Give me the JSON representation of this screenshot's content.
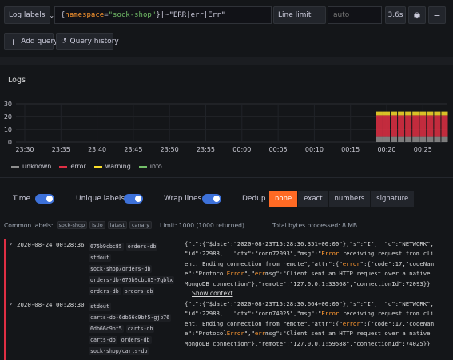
{
  "query_bar": {
    "log_labels_label": "Log labels",
    "query_parts": [
      {
        "text": "{",
        "color": "#ccccdc"
      },
      {
        "text": "namespace",
        "color": "#ff9830"
      },
      {
        "text": "=",
        "color": "#ccccdc"
      },
      {
        "text": "\"sock-shop\"",
        "color": "#73bf69"
      },
      {
        "text": "}",
        "color": "#ccccdc"
      },
      {
        "text": "|~\"ERR",
        "color": "#ccccdc"
      },
      {
        "text": "|",
        "color": "#ccccdc"
      },
      {
        "text": "err",
        "color": "#ccccdc"
      },
      {
        "text": "|",
        "color": "#ccccdc"
      },
      {
        "text": "Err\"",
        "color": "#ccccdc"
      }
    ],
    "line_limit_label": "Line limit",
    "line_limit_placeholder": "auto",
    "query_time": "3.6s",
    "add_query_label": "Add query",
    "query_history_label": "Query history"
  },
  "logs_panel": {
    "title": "Logs"
  },
  "chart_data": {
    "type": "bar",
    "stacked": true,
    "title": "",
    "ylim": [
      0,
      30
    ],
    "y_ticks": [
      "30",
      "20",
      "10",
      "0"
    ],
    "x_ticks": [
      "23:30",
      "23:35",
      "23:40",
      "23:45",
      "23:50",
      "23:55",
      "00:00",
      "00:05",
      "00:10",
      "00:15",
      "00:20",
      "00:25"
    ],
    "x": [
      "00:19",
      "00:20",
      "00:21",
      "00:22",
      "00:23",
      "00:24",
      "00:25",
      "00:26",
      "00:27",
      "00:28"
    ],
    "series": [
      {
        "name": "unknown",
        "color": "#8e8e8e",
        "values": [
          4,
          4,
          4,
          4,
          4,
          4,
          4,
          4,
          4,
          4
        ]
      },
      {
        "name": "error",
        "color": "#e02f44",
        "values": [
          17,
          17,
          17,
          17,
          17,
          17,
          17,
          17,
          17,
          17
        ]
      },
      {
        "name": "warning",
        "color": "#fade2a",
        "values": [
          3,
          3,
          3,
          3,
          3,
          3,
          3,
          3,
          3,
          3
        ]
      },
      {
        "name": "info",
        "color": "#73bf69",
        "values": [
          0,
          0,
          0,
          0,
          0,
          0,
          0,
          0,
          0,
          0
        ]
      }
    ],
    "legend_position": "bottom-left",
    "grid": true
  },
  "options": {
    "time_label": "Time",
    "unique_labels_label": "Unique labels",
    "wrap_lines_label": "Wrap lines",
    "dedup_label": "Dedup",
    "dedup_options": [
      "none",
      "exact",
      "numbers",
      "signature"
    ],
    "dedup_selected": "none",
    "toggles": {
      "time": true,
      "unique_labels": true,
      "wrap_lines": true
    }
  },
  "meta": {
    "common_labels_label": "Common labels:",
    "common_labels": [
      "sock-shop",
      "istio",
      "latest",
      "canary"
    ],
    "limit_text": "Limit: 1000 (1000 returned)",
    "bytes_text": "Total bytes processed: 8 MB"
  },
  "log_rows": [
    {
      "timestamp": "2020-08-24 00:28:36",
      "labels": [
        "675b9cbc85",
        "orders-db",
        "stdout",
        "sock-shop/orders-db",
        "orders-db-675b9cbc85-7gblx",
        "orders-db",
        "orders-db"
      ],
      "lines": [
        "{\"t\":{\"$date\":\"2020-08-23T15:28:36.351+00:00\"},\"s\":\"I\",  \"c\":\"NETWORK\",",
        "\"id\":22988,   \"ctx\":\"conn72093\",\"msg\":\"Error receiving request from cli",
        "ent. Ending connection from remote\",\"attr\":{\"error\":{\"code\":17,\"codeNam",
        "e\":\"ProtocolError\",\"errmsg\":\"Client sent an HTTP request over a native",
        "MongoDB connection\"},\"remote\":\"127.0.0.1:33568\",\"connectionId\":72093}}"
      ],
      "show_context": "Show context"
    },
    {
      "timestamp": "2020-08-24 00:28:30",
      "labels": [
        "stdout",
        "carts-db-6db66c9bf5-gjb76",
        "6db66c9bf5",
        "carts-db",
        "carts-db",
        "orders-db",
        "sock-shop/carts-db"
      ],
      "lines": [
        "{\"t\":{\"$date\":\"2020-08-23T15:28:30.664+00:00\"},\"s\":\"I\",  \"c\":\"NETWORK\",",
        "\"id\":22988,   \"ctx\":\"conn74025\",\"msg\":\"Error receiving request from cli",
        "ent. Ending connection from remote\",\"attr\":{\"error\":{\"code\":17,\"codeNam",
        "e\":\"ProtocolError\",\"errmsg\":\"Client sent an HTTP request over a native",
        "MongoDB connection\"},\"remote\":\"127.0.0.1:59588\",\"connectionId\":74025}}"
      ]
    }
  ]
}
